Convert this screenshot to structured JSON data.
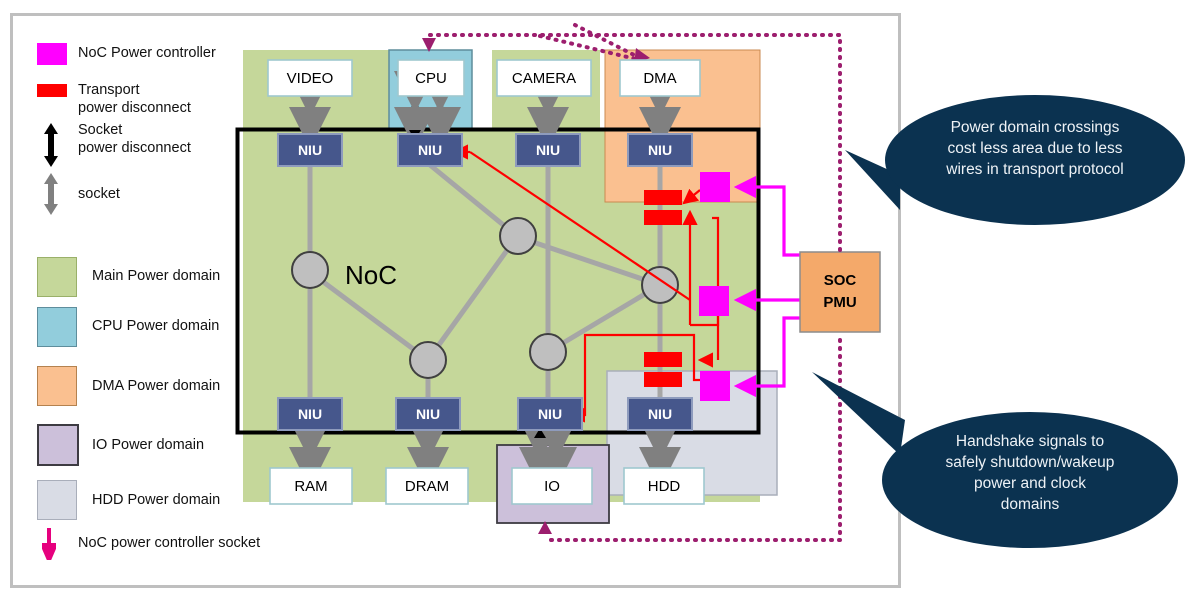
{
  "legend": {
    "items": [
      {
        "id": "noc-power-controller",
        "label": "NoC Power controller",
        "swatch": "#ff00ff",
        "type": "square"
      },
      {
        "id": "transport-power-disconnect",
        "label": "Transport\npower disconnect",
        "swatch": "#ff0000",
        "type": "bar"
      },
      {
        "id": "socket-power-disconnect",
        "label": "Socket\npower disconnect",
        "swatch": "#000000",
        "type": "arrow"
      },
      {
        "id": "socket",
        "label": "socket",
        "swatch": "#808080",
        "type": "arrow"
      }
    ],
    "domains": [
      {
        "id": "main-power-domain",
        "label": "Main Power domain",
        "color": "#c5d79a",
        "border": "#9ab069"
      },
      {
        "id": "cpu-power-domain",
        "label": "CPU Power domain",
        "color": "#92cddc",
        "border": "#5e8d9c"
      },
      {
        "id": "dma-power-domain",
        "label": "DMA Power domain",
        "color": "#fac090",
        "border": "#b4824f"
      },
      {
        "id": "io-power-domain",
        "label": "IO Power domain",
        "color": "#ccc0da",
        "border": "#3d3b42"
      },
      {
        "id": "hdd-power-domain",
        "label": "HDD Power domain",
        "color": "#d9dce5",
        "border": "#a9aeba"
      }
    ],
    "footer": {
      "id": "noc-power-controller-socket",
      "label": "NoC power controller socket",
      "color": "#e6007e"
    }
  },
  "diagram": {
    "noc_label": "NoC",
    "ip_blocks": [
      {
        "id": "video",
        "label": "VIDEO"
      },
      {
        "id": "cpu",
        "label": "CPU"
      },
      {
        "id": "camera",
        "label": "CAMERA"
      },
      {
        "id": "dma",
        "label": "DMA"
      },
      {
        "id": "ram",
        "label": "RAM"
      },
      {
        "id": "dram",
        "label": "DRAM"
      },
      {
        "id": "io",
        "label": "IO"
      },
      {
        "id": "hdd",
        "label": "HDD"
      }
    ],
    "niu_label": "NIU",
    "niu_count": 8,
    "pmu": {
      "id": "soc-pmu",
      "line1": "SOC",
      "line2": "PMU",
      "color": "#f4a96a"
    },
    "router_count": 5
  },
  "callouts": [
    {
      "id": "callout-power-domain-crossings",
      "text": "Power domain crossings\ncost less area due to less\nwires in transport protocol",
      "color": "#0b3250"
    },
    {
      "id": "callout-handshake-signals",
      "text": "Handshake signals to\nsafely shutdown/wakeup\npower and clock\ndomains",
      "color": "#0b3250"
    }
  ],
  "colors": {
    "main": "#c5d79a",
    "cpu": "#92cddc",
    "dma": "#fac090",
    "io": "#ccc0da",
    "hdd": "#d9dce5",
    "niu": "#46578c",
    "router": "#bfbfbf",
    "link": "#a6a6a6",
    "red": "#ff0000",
    "magenta": "#ff00ff",
    "dotted": "#9c1e6e",
    "callout": "#0b3250",
    "frame": "#bfbfbf"
  }
}
